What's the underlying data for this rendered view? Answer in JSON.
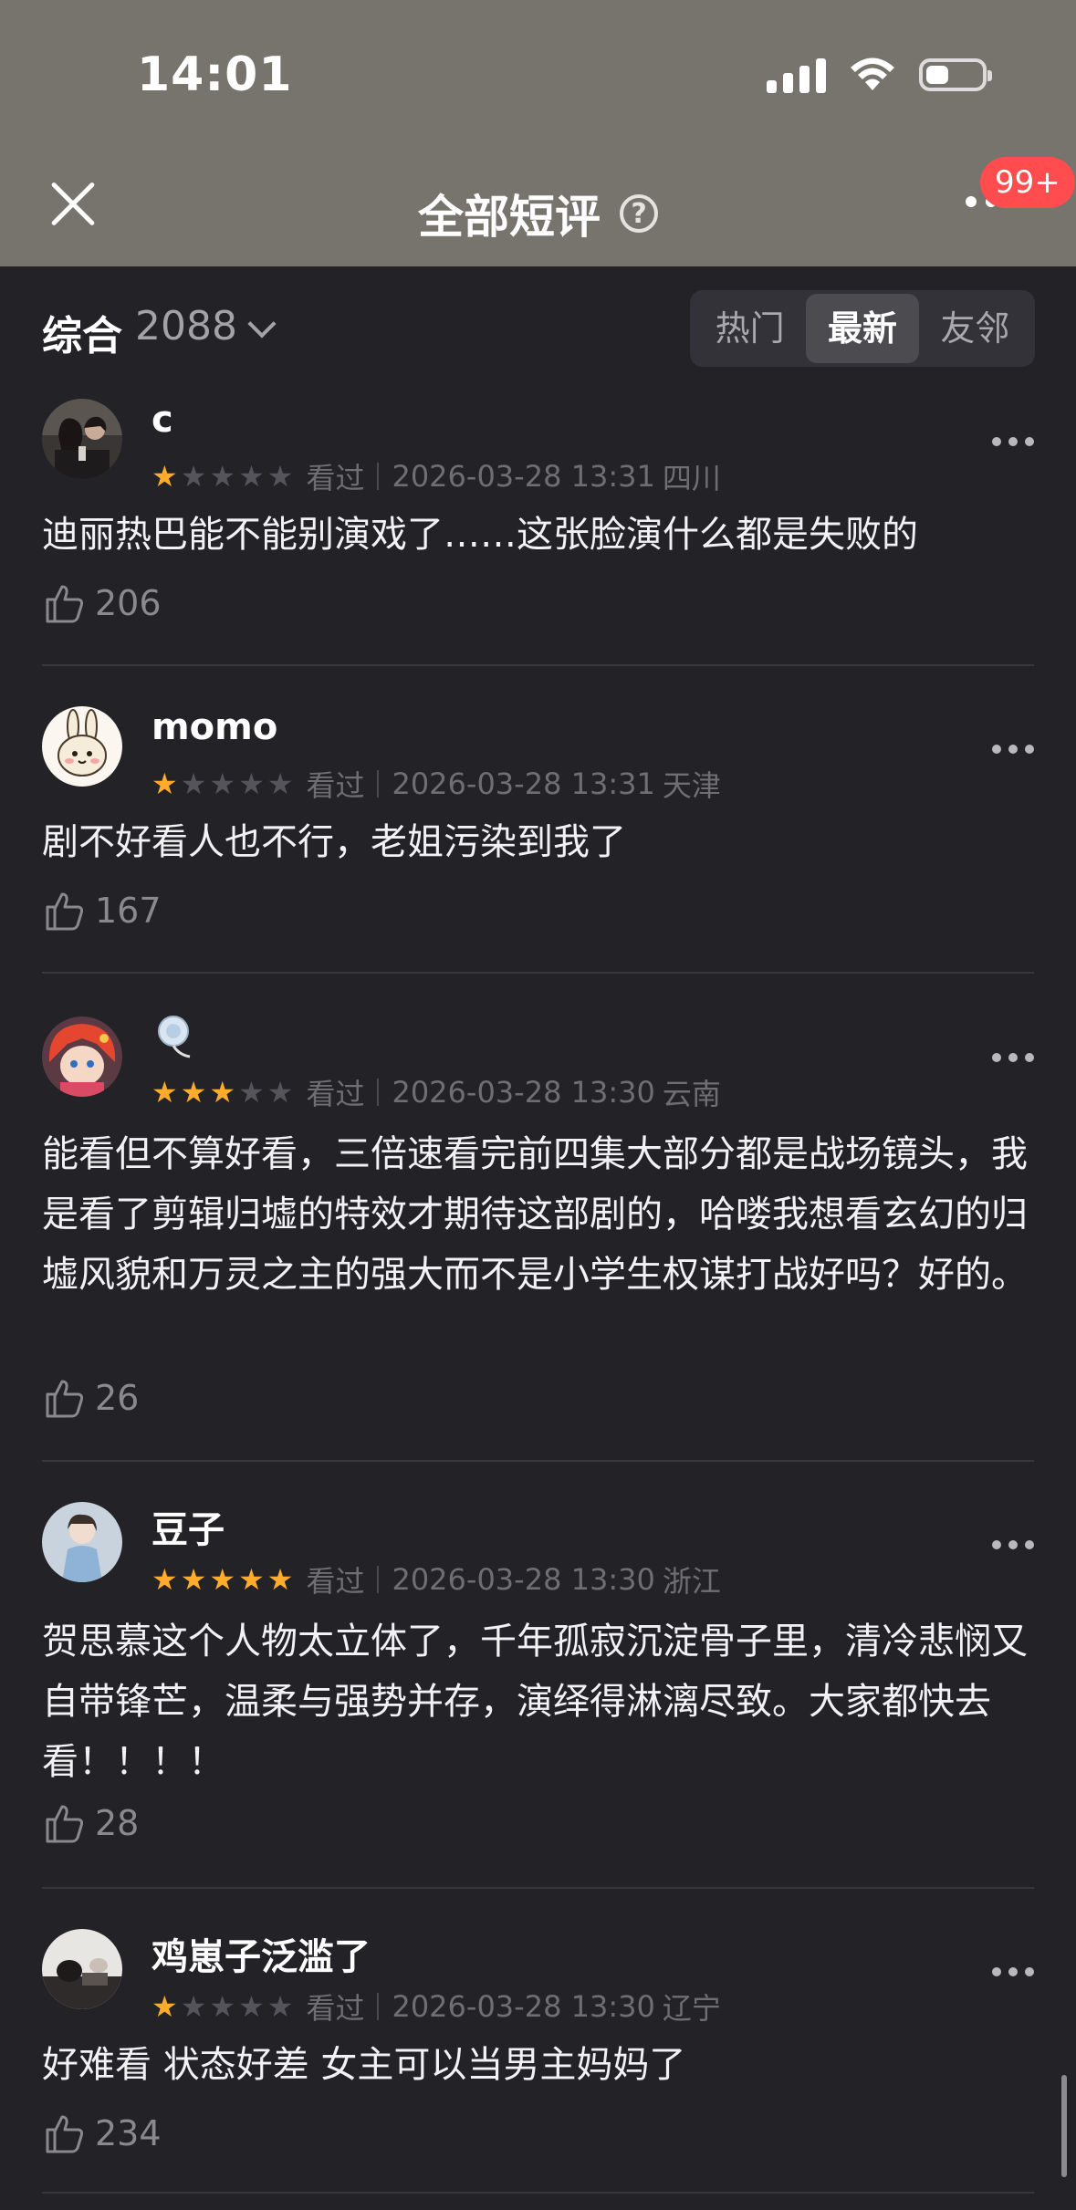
{
  "status_bar": {
    "time": "14:01"
  },
  "nav": {
    "title": "全部短评",
    "badge": "99+"
  },
  "filter": {
    "sort_label": "综合",
    "count": "2088",
    "tabs": [
      {
        "label": "热门",
        "active": false
      },
      {
        "label": "最新",
        "active": true
      },
      {
        "label": "友邻",
        "active": false
      }
    ]
  },
  "reviews": [
    {
      "user": "c",
      "rating": 1,
      "status": "看过",
      "datetime": "2026-03-28 13:31",
      "location": "四川",
      "text": "迪丽热巴能不能别演戏了……这张脸演什么都是失败的",
      "likes": "206"
    },
    {
      "user": "momo",
      "rating": 1,
      "status": "看过",
      "datetime": "2026-03-28 13:31",
      "location": "天津",
      "text": "剧不好看人也不行，老姐污染到我了",
      "likes": "167"
    },
    {
      "user": "",
      "rating": 3,
      "status": "看过",
      "datetime": "2026-03-28 13:30",
      "location": "云南",
      "text": "能看但不算好看，三倍速看完前四集大部分都是战场镜头，我是看了剪辑归墟的特效才期待这部剧的，哈喽我想看玄幻的归墟风貌和万灵之主的强大而不是小学生权谋打战好吗？好的。",
      "likes": "26"
    },
    {
      "user": "豆子",
      "rating": 5,
      "status": "看过",
      "datetime": "2026-03-28 13:30",
      "location": "浙江",
      "text": "贺思慕这个人物太立体了，千年孤寂沉淀骨子里，清冷悲悯又自带锋芒，温柔与强势并存，演绎得淋漓尽致。大家都快去看！！！！",
      "likes": "28"
    },
    {
      "user": "鸡崽子泛滥了",
      "rating": 1,
      "status": "看过",
      "datetime": "2026-03-28 13:30",
      "location": "辽宁",
      "text": "好难看 状态好差 女主可以当男主妈妈了",
      "likes": "234"
    }
  ],
  "colors": {
    "star_on": "#ffac2d",
    "star_off": "#55545a",
    "header_bg": "#77736d",
    "bg": "#232227"
  }
}
